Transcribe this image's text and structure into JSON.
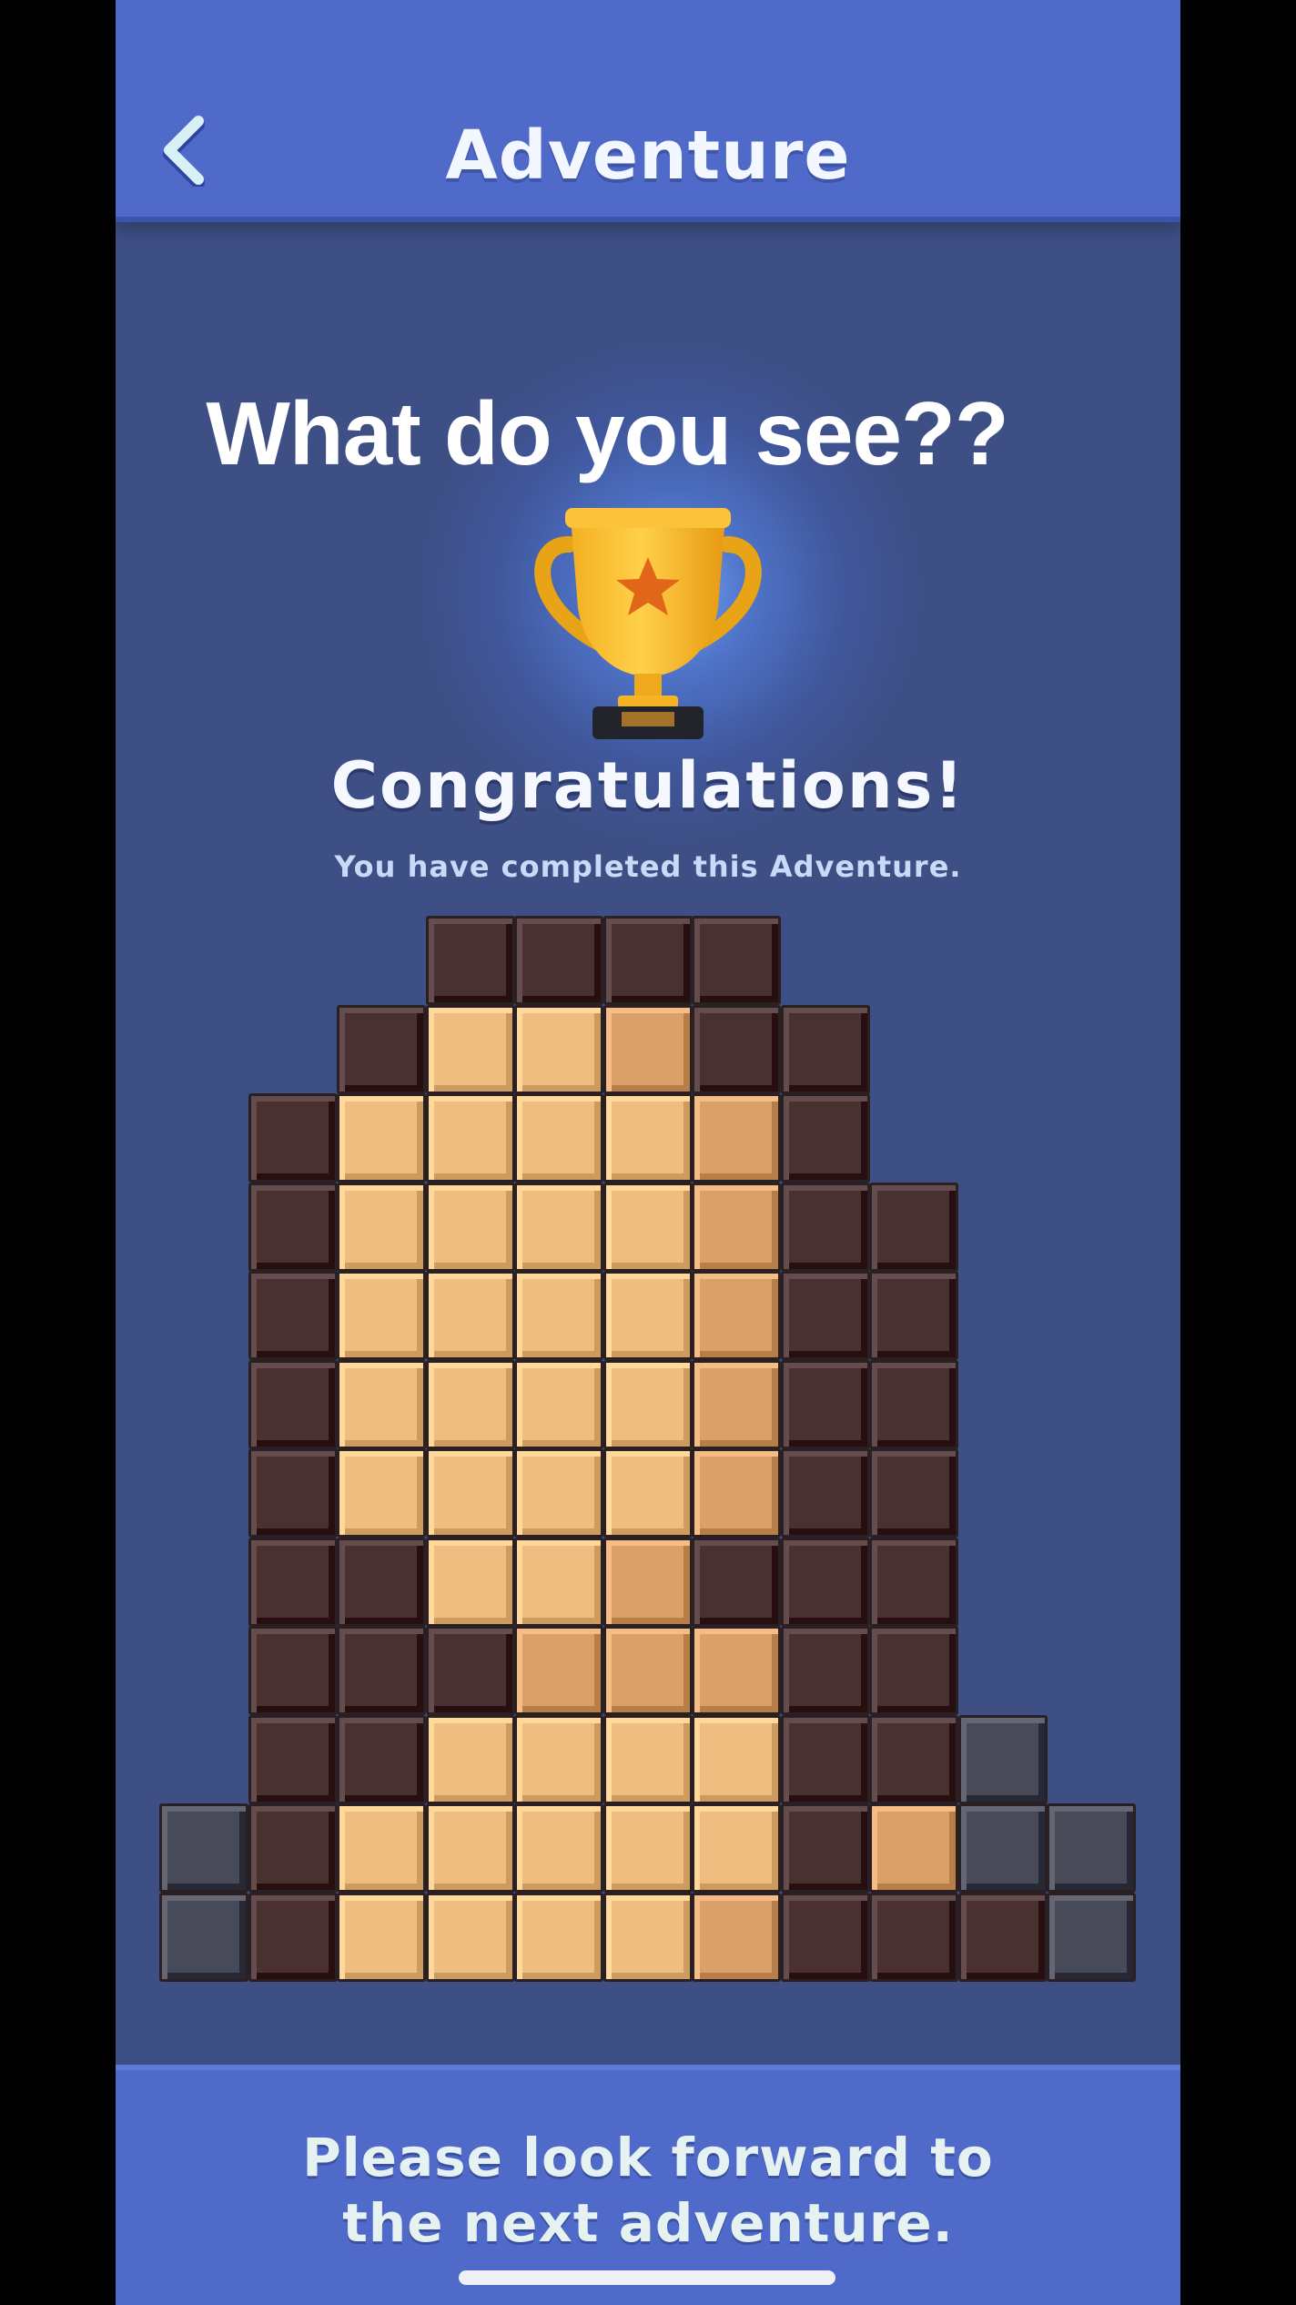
{
  "header": {
    "back_icon": "chevron-left-icon",
    "title": "Adventure"
  },
  "result": {
    "question": "What do you see??",
    "trophy_icon": "trophy-icon",
    "congrats": "Congratulations!",
    "subtitle": "You have completed this Adventure."
  },
  "mosaic": {
    "columns": 11,
    "rows": 12,
    "legend": {
      "D": "dark-brown",
      "L": "light-tan",
      "M": "medium-tan",
      "G": "gray",
      ".": "empty"
    },
    "colors": {
      "D": "#4a3131",
      "L": "#f0bd80",
      "M": "#d9a06a",
      "G": "#484a57"
    },
    "grid": [
      "...DDDD....",
      "..DLLMDD...",
      ".DLLLLMD...",
      ".DLLLLMDD..",
      ".DLLLLMDD..",
      ".DLLLLMDD..",
      ".DLLLLMDD..",
      ".DDLLMDDD..",
      ".DDDMMMDD..",
      ".DDLLLLDDG.",
      "GDLLLLLDMGG",
      "GDLLLLMDDDG"
    ]
  },
  "footer": {
    "line1": "Please look forward to",
    "line2": "the next adventure."
  }
}
